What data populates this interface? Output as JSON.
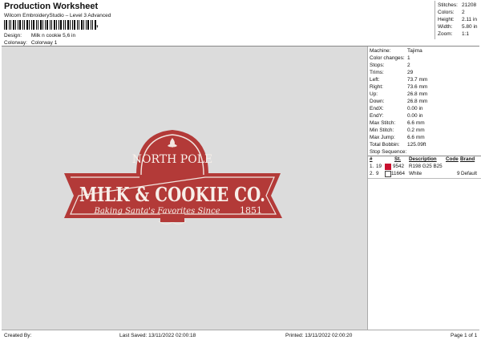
{
  "header": {
    "title": "Production Worksheet",
    "subtitle": "Wilcom EmbroideryStudio – Level 3 Advanced",
    "barcode_suffix": ",",
    "design_label": "Design:",
    "design_value": "Milk n cookie 5,6 in",
    "colorway_label": "Colorway:",
    "colorway_value": "Colorway 1"
  },
  "stats": [
    {
      "label": "Stitches:",
      "value": "21208"
    },
    {
      "label": "Colors:",
      "value": "2"
    },
    {
      "label": "Height:",
      "value": "2.11 in"
    },
    {
      "label": "Width:",
      "value": "5.80 in"
    },
    {
      "label": "Zoom:",
      "value": "1:1"
    }
  ],
  "design": {
    "top_text": "NORTH POLE",
    "main_text": "MILK & COOKIE CO.",
    "script_text": "Baking Santa's Favorites Since",
    "year": "1851",
    "colors": {
      "fill": "#b33a38",
      "outline": "#f2e6e0",
      "text": "#f7efe9"
    }
  },
  "machine_info": [
    {
      "label": "Machine:",
      "value": "Tajima"
    },
    {
      "label": "Color changes:",
      "value": "1"
    },
    {
      "label": "Stops:",
      "value": "2"
    },
    {
      "label": "Trims:",
      "value": "29"
    },
    {
      "label": "Left:",
      "value": "73.7 mm"
    },
    {
      "label": "Right:",
      "value": "73.6 mm"
    },
    {
      "label": "Up:",
      "value": "26.8 mm"
    },
    {
      "label": "Down:",
      "value": "26.8 mm"
    },
    {
      "label": "EndX:",
      "value": "0.00 in"
    },
    {
      "label": "EndY:",
      "value": "0.00 in"
    },
    {
      "label": "Max Stitch:",
      "value": "6.6 mm"
    },
    {
      "label": "Min Stitch:",
      "value": "0.2 mm"
    },
    {
      "label": "Max Jump:",
      "value": "6.6 mm"
    },
    {
      "label": "Total Bobbin:",
      "value": "125.09ft"
    }
  ],
  "stop_sequence": {
    "title": "Stop Sequence:",
    "headers": {
      "n": "#",
      "st": "St.",
      "description": "Description",
      "code": "Code",
      "brand": "Brand"
    },
    "rows": [
      {
        "n": "1.",
        "stop": "19",
        "color": "#c8102e",
        "st": "9542",
        "description": "R198 G25 B25",
        "code": "",
        "brand": ""
      },
      {
        "n": "2.",
        "stop": "9",
        "color": "#ffffff",
        "st": "11664",
        "description": "White",
        "code": "9",
        "brand": "Default"
      }
    ]
  },
  "footer": {
    "created_by": "Created By:",
    "last_saved": "Last Saved: 13/11/2022 02:00:18",
    "printed": "Printed: 13/11/2022 02:00:20",
    "page": "Page 1 of 1"
  }
}
